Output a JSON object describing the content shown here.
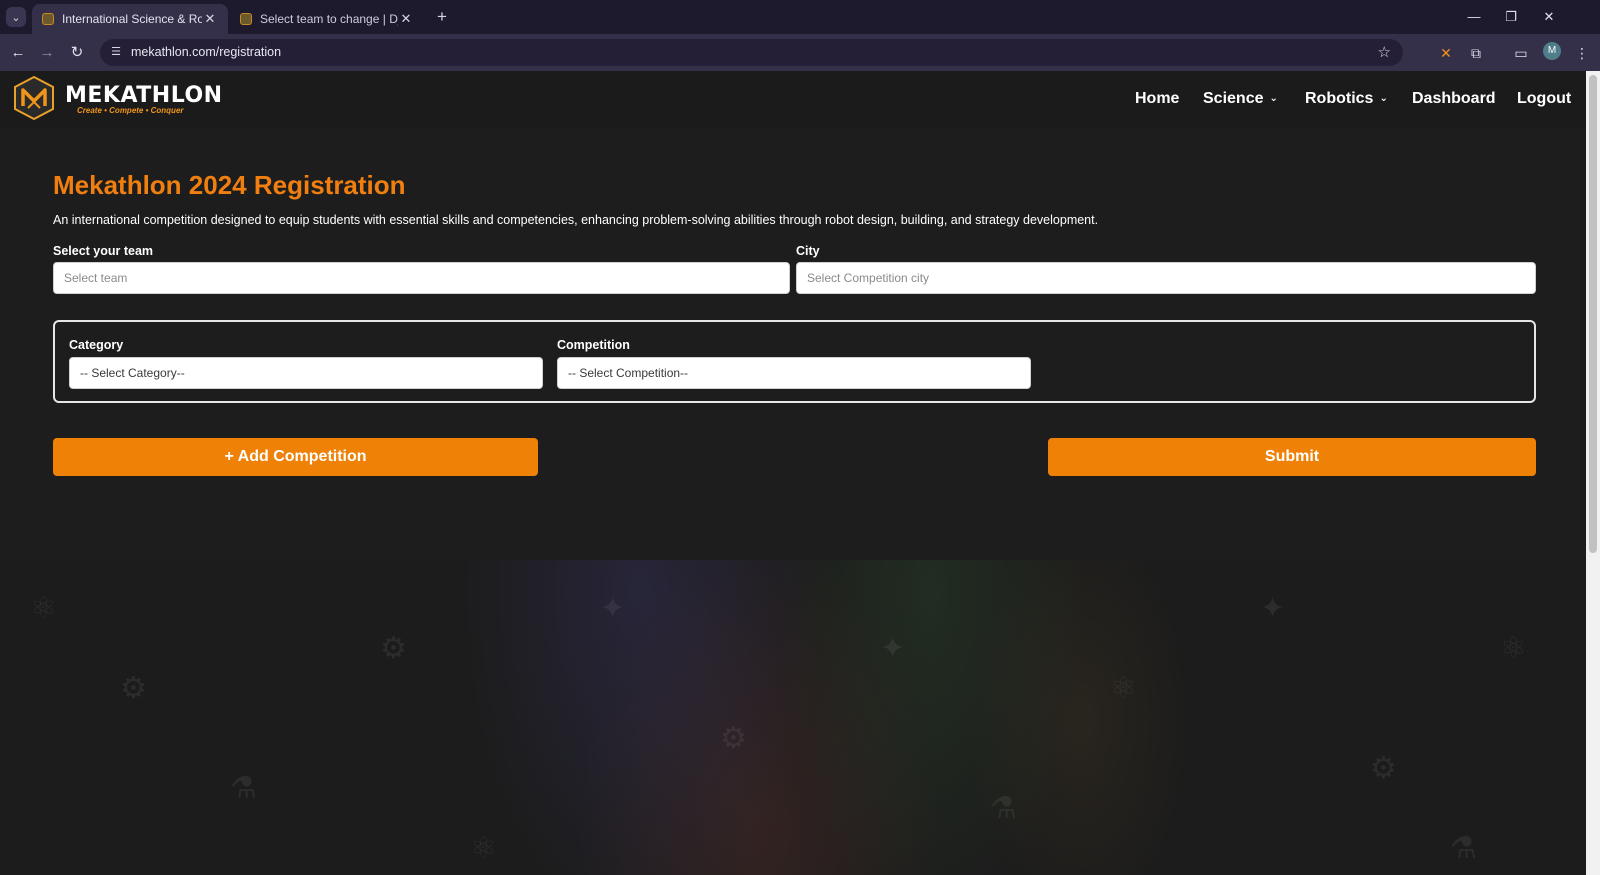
{
  "browser": {
    "tabs": [
      {
        "title": "International Science & Robotic",
        "active": true
      },
      {
        "title": "Select team to change | Django",
        "active": false
      }
    ],
    "url": "mekathlon.com/registration",
    "profile_initial": "M"
  },
  "navbar": {
    "brand": "MEKATHLON",
    "tagline": "Create • Compete • Conquer",
    "items": [
      {
        "label": "Home",
        "dropdown": false
      },
      {
        "label": "Science",
        "dropdown": true
      },
      {
        "label": "Robotics",
        "dropdown": true
      },
      {
        "label": "Dashboard",
        "dropdown": false
      },
      {
        "label": "Logout",
        "dropdown": false
      }
    ]
  },
  "form": {
    "title": "Mekathlon 2024 Registration",
    "description": "An international competition designed to equip students with essential skills and competencies, enhancing problem-solving abilities through robot design, building, and strategy development.",
    "team": {
      "label": "Select your team",
      "placeholder": "Select team"
    },
    "city": {
      "label": "City",
      "placeholder": "Select Competition city"
    },
    "category": {
      "label": "Category",
      "selected": "-- Select Category--"
    },
    "competition": {
      "label": "Competition",
      "selected": "-- Select Competition--"
    },
    "add_button": "+ Add Competition",
    "submit_button": "Submit"
  },
  "colors": {
    "accent": "#ee8106",
    "title": "#f07f10",
    "page_bg": "#1c1c1c"
  }
}
